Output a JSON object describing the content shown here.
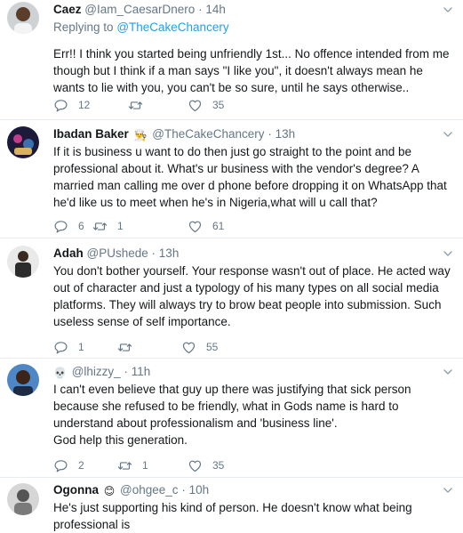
{
  "tweets": [
    {
      "name": "Caez",
      "handle": "@Iam_CaesarDnero",
      "time": "14h",
      "reply_prefix": "Replying to",
      "reply_to": "@TheCakeChancery",
      "text": "Err!! I think you started being unfriendly 1st... No offence intended from me though but I think if a man says \"I like you\", it doesn't always mean he wants to lie with you, you can't be so sure, until he says otherwise..",
      "reply_count": "12",
      "retweet_count": "",
      "like_count": "35"
    },
    {
      "name": "Ibadan Baker",
      "name_emoji": "👨‍🍳",
      "handle": "@TheCakeChancery",
      "time": "13h",
      "text": "If it is business u want to do then just go straight to the point and be professional about it. What's ur business with the vendor's degree? A married man calling me over d phone before dropping it on WhatsApp that he'd like us to meet when he's in Nigeria,what will u call that?",
      "reply_count": "6",
      "retweet_count": "1",
      "like_count": "61"
    },
    {
      "name": "Adah",
      "handle": "@PUshede",
      "time": "13h",
      "text": "You don't bother yourself. Your response wasn't out of place. He acted way out of character and just a typology of his many types on all social media platforms. They will always try to brow beat people into submission. Such useless sense of self importance.",
      "reply_count": "1",
      "retweet_count": "",
      "like_count": "55"
    },
    {
      "name": "",
      "name_emoji": "💀",
      "handle": "@lhizzy_",
      "time": "11h",
      "text": "I can't even believe that guy up there was justifying that sick person because she refused to be friendly, what in Gods name is hard to understand about professionalism and 'business line'.\nGod help this generation.",
      "reply_count": "2",
      "retweet_count": "1",
      "like_count": "35"
    },
    {
      "name": "Ogonna",
      "name_emoji": "😊",
      "handle": "@ohgee_c",
      "time": "10h",
      "text": "He's just supporting his kind of person. He doesn't know what being professional is"
    }
  ],
  "separator": "·",
  "icons": {
    "reply": "reply-icon",
    "retweet": "retweet-icon",
    "like": "heart-icon",
    "menu": "chevron-down-icon"
  },
  "colors": {
    "text": "#14171a",
    "muted": "#657786",
    "link": "#1da1f2",
    "divider": "#e6ecf0"
  }
}
